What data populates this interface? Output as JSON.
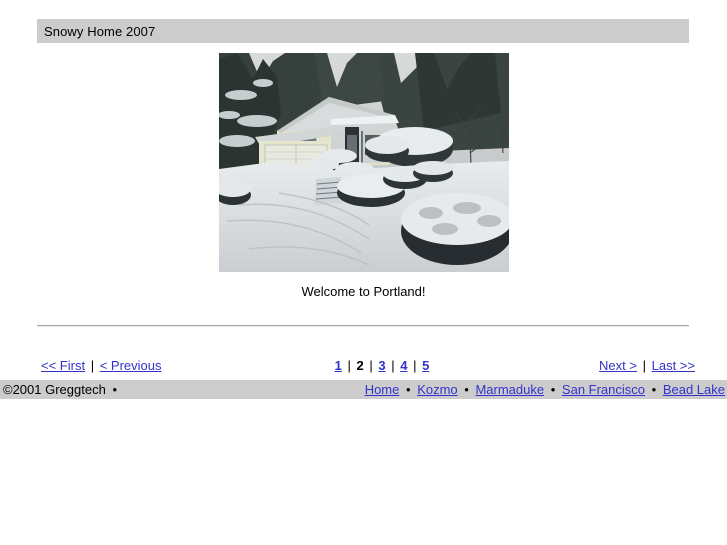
{
  "header": {
    "title": "Snowy Home 2007",
    "background_color": "#cccccc"
  },
  "photo": {
    "alt": "Snow-covered suburban house with driveway, garage, stone steps and snowy shrubs",
    "caption": "Welcome to Portland!"
  },
  "pager": {
    "first_label": "<< First",
    "previous_label": "< Previous",
    "next_label": "Next >",
    "last_label": "Last >>",
    "separator": "|",
    "pages": [
      {
        "label": "1",
        "current": false
      },
      {
        "label": "2",
        "current": true
      },
      {
        "label": "3",
        "current": false
      },
      {
        "label": "4",
        "current": false
      },
      {
        "label": "5",
        "current": false
      }
    ]
  },
  "footer": {
    "copyright": "©2001 Greggtech",
    "bullet": "•",
    "background_color": "#cccccc",
    "links": [
      {
        "label": "Home"
      },
      {
        "label": "Kozmo"
      },
      {
        "label": "Marmaduke"
      },
      {
        "label": "San Francisco"
      },
      {
        "label": "Bead Lake"
      }
    ]
  },
  "colors": {
    "link": "#3333cc",
    "bar": "#cccccc",
    "text": "#000000"
  }
}
